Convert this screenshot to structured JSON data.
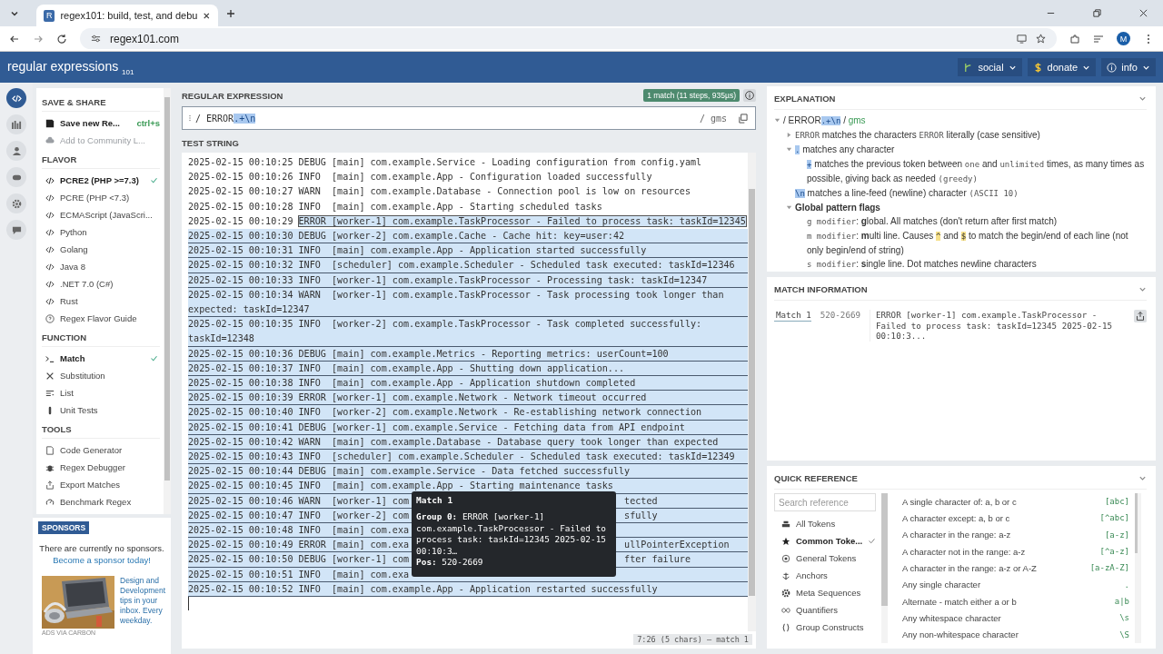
{
  "browser": {
    "tab_icon": "R",
    "tab_title": "regex101: build, test, and debu",
    "url": "regex101.com",
    "avatar": "M"
  },
  "header": {
    "logo_bold": "regular",
    "logo_light": "expressions",
    "logo_sub": "101",
    "nav": [
      {
        "label": "social"
      },
      {
        "label": "donate"
      },
      {
        "label": "info"
      }
    ]
  },
  "rail": [
    {
      "selected": true
    },
    {
      "selected": false
    },
    {
      "selected": false
    },
    {
      "selected": false
    },
    {
      "selected": false
    },
    {
      "selected": false
    }
  ],
  "sidebar": {
    "sections": [
      {
        "title": "SAVE & SHARE",
        "items": [
          {
            "label": "Save new Re...",
            "shortcut": "ctrl+s",
            "disabled": false
          },
          {
            "label": "Add to Community L...",
            "disabled": true
          }
        ]
      },
      {
        "title": "FLAVOR",
        "items": [
          {
            "label": "PCRE2 (PHP >=7.3)",
            "selected": true
          },
          {
            "label": "PCRE (PHP <7.3)",
            "selected": false
          },
          {
            "label": "ECMAScript (JavaScri...",
            "selected": false
          },
          {
            "label": "Python",
            "selected": false
          },
          {
            "label": "Golang",
            "selected": false
          },
          {
            "label": "Java 8",
            "selected": false
          },
          {
            "label": ".NET 7.0 (C#)",
            "selected": false
          },
          {
            "label": "Rust",
            "selected": false
          },
          {
            "label": "Regex Flavor Guide"
          }
        ]
      },
      {
        "title": "FUNCTION",
        "items": [
          {
            "label": "Match",
            "selected": true
          },
          {
            "label": "Substitution",
            "selected": false
          },
          {
            "label": "List",
            "selected": false
          },
          {
            "label": "Unit Tests",
            "selected": false
          }
        ]
      },
      {
        "title": "TOOLS",
        "items": [
          {
            "label": "Code Generator"
          },
          {
            "label": "Regex Debugger"
          },
          {
            "label": "Export Matches"
          },
          {
            "label": "Benchmark Regex"
          }
        ]
      }
    ]
  },
  "sponsors": {
    "badge": "SPONSORS",
    "text": "There are currently no sponsors.",
    "link": "Become a sponsor today!",
    "ad_text": "Design and Development tips in your inbox. Every weekday.",
    "ad_credit": "ADS VIA CARBON"
  },
  "regex": {
    "label": "REGULAR EXPRESSION",
    "match_badge": "1 match (11 steps, 935µs)",
    "open": "/",
    "pattern": "ERROR",
    "pattern_hl": ".+\\n",
    "flags": "/ gms"
  },
  "test_string": {
    "label": "TEST STRING",
    "lines": [
      {
        "text": "2025-02-15 00:10:25 DEBUG [main] com.example.Service - Loading configuration from config.yaml",
        "matched": false
      },
      {
        "text": "2025-02-15 00:10:26 INFO  [main] com.example.App - Configuration loaded successfully",
        "matched": false
      },
      {
        "text": "2025-02-15 00:10:27 WARN  [main] com.example.Database - Connection pool is low on resources",
        "matched": false
      },
      {
        "text": "2025-02-15 00:10:28 INFO  [main] com.example.App - Starting scheduled tasks",
        "matched": false
      },
      {
        "plain": "2025-02-15 00:10:29 ",
        "text": "ERROR [worker-1] com.example.TaskProcessor - Failed to process task: taskId=12345",
        "matched": true
      },
      {
        "text": "2025-02-15 00:10:30 DEBUG [worker-2] com.example.Cache - Cache hit: key=user:42",
        "matched": true
      },
      {
        "text": "2025-02-15 00:10:31 INFO  [main] com.example.App - Application started successfully",
        "matched": true
      },
      {
        "text": "2025-02-15 00:10:32 INFO  [scheduler] com.example.Scheduler - Scheduled task executed: taskId=12346",
        "matched": true
      },
      {
        "text": "2025-02-15 00:10:33 INFO  [worker-1] com.example.TaskProcessor - Processing task: taskId=12347",
        "matched": true
      },
      {
        "text": "2025-02-15 00:10:34 WARN  [worker-1] com.example.TaskProcessor - Task processing took longer than expected: taskId=12347",
        "matched": true
      },
      {
        "text": "2025-02-15 00:10:35 INFO  [worker-2] com.example.TaskProcessor - Task completed successfully: taskId=12348",
        "matched": true
      },
      {
        "text": "2025-02-15 00:10:36 DEBUG [main] com.example.Metrics - Reporting metrics: userCount=100",
        "matched": true
      },
      {
        "text": "2025-02-15 00:10:37 INFO  [main] com.example.App - Shutting down application...",
        "matched": true
      },
      {
        "text": "2025-02-15 00:10:38 INFO  [main] com.example.App - Application shutdown completed",
        "matched": true
      },
      {
        "text": "2025-02-15 00:10:39 ERROR [worker-1] com.example.Network - Network timeout occurred",
        "matched": true
      },
      {
        "text": "2025-02-15 00:10:40 INFO  [worker-2] com.example.Network - Re-establishing network connection",
        "matched": true
      },
      {
        "text": "2025-02-15 00:10:41 DEBUG [worker-1] com.example.Service - Fetching data from API endpoint",
        "matched": true
      },
      {
        "text": "2025-02-15 00:10:42 WARN  [main] com.example.Database - Database query took longer than expected",
        "matched": true
      },
      {
        "text": "2025-02-15 00:10:43 INFO  [scheduler] com.example.Scheduler - Scheduled task executed: taskId=12349",
        "matched": true
      },
      {
        "text": "2025-02-15 00:10:44 DEBUG [main] com.example.Service - Data fetched successfully",
        "matched": true
      },
      {
        "text": "2025-02-15 00:10:45 INFO  [main] com.example.App - Starting maintenance tasks",
        "matched": true
      },
      {
        "text": "2025-02-15 00:10:46 WARN  [worker-1] com",
        "right": "tected",
        "matched": true,
        "tooltip": true
      },
      {
        "text": "2025-02-15 00:10:47 INFO  [worker-2] com",
        "right": "sfully",
        "matched": true
      },
      {
        "text": "2025-02-15 00:10:48 INFO  [main] com.exa",
        "matched": true
      },
      {
        "text": "2025-02-15 00:10:49 ERROR [main] com.exa",
        "right": "ullPointerException",
        "matched": true
      },
      {
        "text": "2025-02-15 00:10:50 DEBUG [worker-1] com",
        "right": "fter failure",
        "matched": true
      },
      {
        "text": "2025-02-15 00:10:51 INFO  [main] com.exa",
        "matched": true
      },
      {
        "text": "2025-02-15 00:10:52 INFO  [main] com.example.App - Application restarted successfully",
        "matched": true
      }
    ],
    "status": "7:26 (5 chars) – match 1",
    "tooltip": {
      "title": "Match 1",
      "group": "**Group 0:** ERROR [worker-1] com.example.TaskProcessor - Failed to process task: taskId=12345 2025-02-15 00:10:3…",
      "pos": "**Pos:** 520-2669"
    }
  },
  "explanation": {
    "title": "EXPLANATION",
    "tree": {
      "expanded": true,
      "segs": [
        {
          "t": "/ ERROR",
          "kind": "plain"
        },
        {
          "t": ".+\\n",
          "kind": "hl"
        },
        {
          "t": " / ",
          "kind": "plain"
        },
        {
          "t": "gms",
          "kind": "green"
        }
      ],
      "children": [
        {
          "expanded": false,
          "segs": [
            {
              "t": "ERROR",
              "kind": "mono"
            },
            {
              "t": " matches the characters ",
              "kind": "plain"
            },
            {
              "t": "ERROR",
              "kind": "mono"
            },
            {
              "t": " literally (case sensitive)",
              "kind": "plain"
            }
          ]
        },
        {
          "expanded": true,
          "segs": [
            {
              "t": ".",
              "kind": "hl"
            },
            {
              "t": " matches any character",
              "kind": "plain"
            }
          ],
          "children": [
            {
              "segs": [
                {
                  "t": "+",
                  "kind": "hl"
                },
                {
                  "t": " matches the previous token between ",
                  "kind": "plain"
                },
                {
                  "t": "one",
                  "kind": "mono"
                },
                {
                  "t": " and ",
                  "kind": "plain"
                },
                {
                  "t": "unlimited",
                  "kind": "mono"
                },
                {
                  "t": " times, as many times as possible, giving back as needed ",
                  "kind": "plain"
                },
                {
                  "t": "(greedy)",
                  "kind": "mono"
                }
              ]
            }
          ]
        },
        {
          "segs": [
            {
              "t": "\\n",
              "kind": "hl"
            },
            {
              "t": " matches a line-feed (newline) character ",
              "kind": "plain"
            },
            {
              "t": "(ASCII 10)",
              "kind": "mono"
            }
          ]
        },
        {
          "expanded": true,
          "segs": [
            {
              "t": "Global pattern flags",
              "kind": "bold"
            }
          ],
          "children": [
            {
              "segs": [
                {
                  "t": "g modifier",
                  "kind": "mono"
                },
                {
                  "t": ": ",
                  "kind": "plain"
                },
                {
                  "t": "g",
                  "kind": "bold"
                },
                {
                  "t": "lobal. All matches (don't return after first match)",
                  "kind": "plain"
                }
              ]
            },
            {
              "segs": [
                {
                  "t": "m modifier",
                  "kind": "mono"
                },
                {
                  "t": ": ",
                  "kind": "plain"
                },
                {
                  "t": "m",
                  "kind": "bold"
                },
                {
                  "t": "ulti line. Causes ",
                  "kind": "plain"
                },
                {
                  "t": "^",
                  "kind": "yel"
                },
                {
                  "t": " and ",
                  "kind": "plain"
                },
                {
                  "t": "$",
                  "kind": "yel"
                },
                {
                  "t": " to match the begin/end of each line (not only begin/end of string)",
                  "kind": "plain"
                }
              ]
            },
            {
              "segs": [
                {
                  "t": "s modifier",
                  "kind": "mono"
                },
                {
                  "t": ": ",
                  "kind": "plain"
                },
                {
                  "t": "s",
                  "kind": "bold"
                },
                {
                  "t": "ingle line. Dot matches newline characters",
                  "kind": "plain"
                }
              ]
            }
          ]
        }
      ]
    }
  },
  "match_info": {
    "title": "MATCH INFORMATION",
    "rows": [
      {
        "label": "Match 1",
        "range": "520-2669",
        "text": "ERROR [worker-1] com.example.TaskProcessor - Failed to process task: taskId=12345 2025-02-15 00:10:3..."
      }
    ]
  },
  "quick_reference": {
    "title": "QUICK REFERENCE",
    "search_placeholder": "Search reference",
    "categories": [
      {
        "label": "All Tokens",
        "selected": false
      },
      {
        "label": "Common Toke...",
        "selected": true
      },
      {
        "label": "General Tokens",
        "selected": false
      },
      {
        "label": "Anchors",
        "selected": false
      },
      {
        "label": "Meta Sequences",
        "selected": false
      },
      {
        "label": "Quantifiers",
        "selected": false
      },
      {
        "label": "Group Constructs",
        "selected": false
      }
    ],
    "tokens": [
      {
        "desc": "A single character of: a, b or c",
        "token": "[abc]"
      },
      {
        "desc": "A character except: a, b or c",
        "token": "[^abc]"
      },
      {
        "desc": "A character in the range: a-z",
        "token": "[a-z]"
      },
      {
        "desc": "A character not in the range: a-z",
        "token": "[^a-z]"
      },
      {
        "desc": "A character in the range: a-z or A-Z",
        "token": "[a-zA-Z]"
      },
      {
        "desc": "Any single character",
        "token": "."
      },
      {
        "desc": "Alternate - match either a or b",
        "token": "a|b"
      },
      {
        "desc": "Any whitespace character",
        "token": "\\s"
      },
      {
        "desc": "Any non-whitespace character",
        "token": "\\S"
      }
    ]
  }
}
